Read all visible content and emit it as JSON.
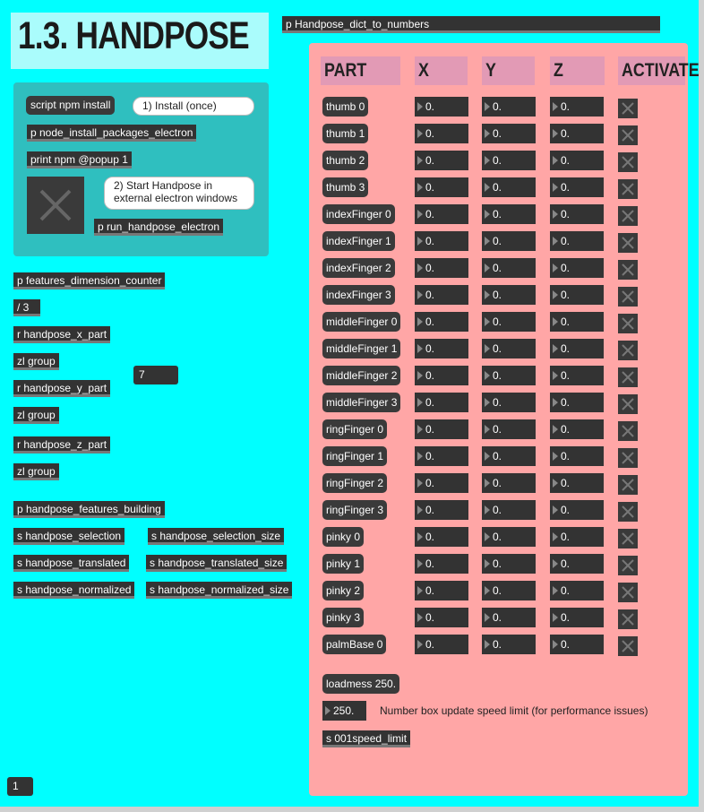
{
  "title": "1.3. HANDPOSE",
  "install": {
    "script_label": "script npm install",
    "install_comment": "1) Install (once)",
    "node_install": "p node_install_packages_electron",
    "print_popup": "print npm @popup 1",
    "start_comment": "2) Start Handpose in external electron windows",
    "run_handpose": "p run_handpose_electron"
  },
  "left_objects": {
    "features_counter": "p features_dimension_counter",
    "divide": "/ 3",
    "r_x": "r handpose_x_part",
    "zl1": "zl group",
    "r_y": "r handpose_y_part",
    "zl2": "zl group",
    "r_z": "r handpose_z_part",
    "zl3": "zl group",
    "count_value": "7",
    "features_building": "p handpose_features_building",
    "s_selection": "s handpose_selection",
    "s_selection_size": "s handpose_selection_size",
    "s_translated": "s handpose_translated",
    "s_translated_size": "s handpose_translated_size",
    "s_normalized": "s handpose_normalized",
    "s_normalized_size": "s handpose_normalized_size",
    "bottom_value": "1"
  },
  "dict_to_numbers": "p Handpose_dict_to_numbers",
  "table": {
    "headers": [
      "PART",
      "X",
      "Y",
      "Z",
      "ACTIVATE"
    ],
    "rows": [
      {
        "part": "thumb 0",
        "x": "0.",
        "y": "0.",
        "z": "0."
      },
      {
        "part": "thumb 1",
        "x": "0.",
        "y": "0.",
        "z": "0."
      },
      {
        "part": "thumb 2",
        "x": "0.",
        "y": "0.",
        "z": "0."
      },
      {
        "part": "thumb 3",
        "x": "0.",
        "y": "0.",
        "z": "0."
      },
      {
        "part": "indexFinger 0",
        "x": "0.",
        "y": "0.",
        "z": "0."
      },
      {
        "part": "indexFinger 1",
        "x": "0.",
        "y": "0.",
        "z": "0."
      },
      {
        "part": "indexFinger 2",
        "x": "0.",
        "y": "0.",
        "z": "0."
      },
      {
        "part": "indexFinger 3",
        "x": "0.",
        "y": "0.",
        "z": "0."
      },
      {
        "part": "middleFinger 0",
        "x": "0.",
        "y": "0.",
        "z": "0."
      },
      {
        "part": "middleFinger 1",
        "x": "0.",
        "y": "0.",
        "z": "0."
      },
      {
        "part": "middleFinger 2",
        "x": "0.",
        "y": "0.",
        "z": "0."
      },
      {
        "part": "middleFinger 3",
        "x": "0.",
        "y": "0.",
        "z": "0."
      },
      {
        "part": "ringFinger 0",
        "x": "0.",
        "y": "0.",
        "z": "0."
      },
      {
        "part": "ringFinger 1",
        "x": "0.",
        "y": "0.",
        "z": "0."
      },
      {
        "part": "ringFinger 2",
        "x": "0.",
        "y": "0.",
        "z": "0."
      },
      {
        "part": "ringFinger 3",
        "x": "0.",
        "y": "0.",
        "z": "0."
      },
      {
        "part": "pinky 0",
        "x": "0.",
        "y": "0.",
        "z": "0."
      },
      {
        "part": "pinky 1",
        "x": "0.",
        "y": "0.",
        "z": "0."
      },
      {
        "part": "pinky 2",
        "x": "0.",
        "y": "0.",
        "z": "0."
      },
      {
        "part": "pinky 3",
        "x": "0.",
        "y": "0.",
        "z": "0."
      },
      {
        "part": "palmBase 0",
        "x": "0.",
        "y": "0.",
        "z": "0."
      }
    ]
  },
  "speed": {
    "loadmess": "loadmess 250.",
    "value": "250.",
    "comment": "Number box update speed limit (for performance issues)",
    "send": "s 001speed_limit"
  },
  "colors": {
    "canvas": "#00ffff",
    "panel": "#ffa6a6",
    "header": "#e29ab5",
    "install_panel": "#2fbfbf"
  }
}
